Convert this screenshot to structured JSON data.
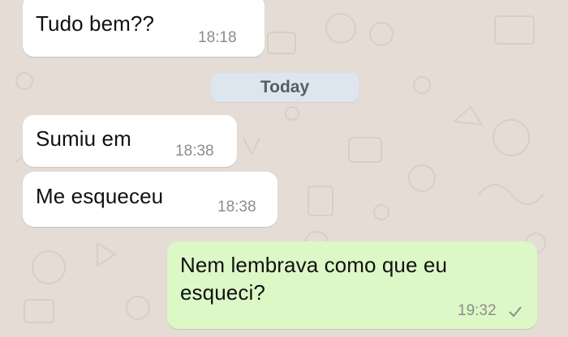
{
  "chat": {
    "date_divider": "Today",
    "messages": [
      {
        "direction": "incoming",
        "text": "Tudo bem??",
        "time": "18:18"
      },
      {
        "direction": "incoming",
        "text": "Sumiu em",
        "time": "18:38"
      },
      {
        "direction": "incoming",
        "text": "Me esqueceu",
        "time": "18:38"
      },
      {
        "direction": "outgoing",
        "text": "Nem lembrava como que eu\nesqueci?",
        "time": "19:32",
        "status_icon": "single-check-icon"
      }
    ]
  },
  "colors": {
    "wallpaper": "#e5ddd5",
    "incoming_bubble": "#ffffff",
    "outgoing_bubble": "#dcf8c6",
    "date_chip": "#dde5ef",
    "timestamp": "#8c8c8c"
  }
}
